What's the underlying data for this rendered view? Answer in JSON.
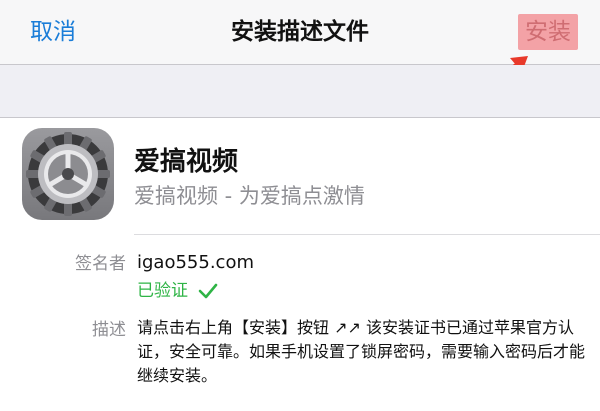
{
  "navbar": {
    "cancel_label": "取消",
    "title": "安装描述文件",
    "install_label": "安装"
  },
  "profile": {
    "app_name": "爱搞视频",
    "app_subtitle": "爱搞视频 - 为爱搞点激情",
    "icon": "settings-gear-icon"
  },
  "details": {
    "signer_label": "签名者",
    "signer_value": "igao555.com",
    "verified_label": "已验证",
    "description_label": "描述",
    "description_text": "请点击右上角【安装】按钮 ↗↗ 该安装证书已通过苹果官方认证，安全可靠。如果手机设置了锁屏密码，需要输入密码后才能继续安装。"
  },
  "colors": {
    "link_blue": "#1a7dd8",
    "install_highlight": "#f3a2a6",
    "annotation_arrow": "#e8392a",
    "verified_green": "#2fb446"
  }
}
